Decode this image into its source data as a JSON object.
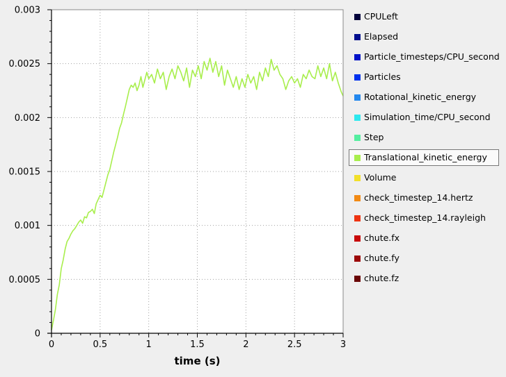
{
  "chart_data": {
    "type": "line",
    "title": "",
    "xlabel": "time (s)",
    "ylabel": "",
    "xlim": [
      0,
      3
    ],
    "ylim": [
      0,
      0.003
    ],
    "x_ticks": [
      {
        "value": 0,
        "label": "0"
      },
      {
        "value": 0.5,
        "label": "0.5"
      },
      {
        "value": 1,
        "label": "1"
      },
      {
        "value": 1.5,
        "label": "1.5"
      },
      {
        "value": 2,
        "label": "2"
      },
      {
        "value": 2.5,
        "label": "2.5"
      },
      {
        "value": 3,
        "label": "3"
      }
    ],
    "y_ticks": [
      {
        "value": 0,
        "label": "0"
      },
      {
        "value": 0.0005,
        "label": "0.0005"
      },
      {
        "value": 0.001,
        "label": "0.001"
      },
      {
        "value": 0.0015,
        "label": "0.0015"
      },
      {
        "value": 0.002,
        "label": "0.002"
      },
      {
        "value": 0.0025,
        "label": "0.0025"
      },
      {
        "value": 0.003,
        "label": "0.003"
      }
    ],
    "grid": true,
    "legend_position": "right",
    "series": [
      {
        "name": "Translational_kinetic_energy",
        "color": "#a8ee4c",
        "x": [
          0,
          0.02,
          0.04,
          0.06,
          0.08,
          0.1,
          0.12,
          0.14,
          0.16,
          0.18,
          0.2,
          0.22,
          0.24,
          0.26,
          0.28,
          0.3,
          0.32,
          0.34,
          0.36,
          0.38,
          0.4,
          0.42,
          0.44,
          0.46,
          0.48,
          0.5,
          0.52,
          0.54,
          0.56,
          0.58,
          0.6,
          0.62,
          0.64,
          0.66,
          0.68,
          0.7,
          0.72,
          0.74,
          0.76,
          0.78,
          0.8,
          0.82,
          0.84,
          0.86,
          0.88,
          0.9,
          0.92,
          0.94,
          0.96,
          0.98,
          1.0,
          1.03,
          1.06,
          1.09,
          1.12,
          1.15,
          1.18,
          1.21,
          1.24,
          1.27,
          1.3,
          1.33,
          1.36,
          1.39,
          1.42,
          1.45,
          1.48,
          1.51,
          1.54,
          1.57,
          1.6,
          1.63,
          1.66,
          1.69,
          1.72,
          1.75,
          1.78,
          1.81,
          1.84,
          1.87,
          1.9,
          1.93,
          1.96,
          1.99,
          2.02,
          2.05,
          2.08,
          2.11,
          2.14,
          2.17,
          2.2,
          2.23,
          2.26,
          2.29,
          2.32,
          2.35,
          2.38,
          2.41,
          2.44,
          2.47,
          2.5,
          2.53,
          2.56,
          2.59,
          2.62,
          2.65,
          2.68,
          2.71,
          2.74,
          2.77,
          2.8,
          2.83,
          2.86,
          2.89,
          2.92,
          2.95,
          2.98,
          3.0
        ],
        "values": [
          3e-05,
          0.00012,
          0.00022,
          0.00036,
          0.00045,
          0.0006,
          0.00068,
          0.00078,
          0.00085,
          0.00088,
          0.00092,
          0.00095,
          0.00097,
          0.001,
          0.00103,
          0.00105,
          0.00102,
          0.00108,
          0.00107,
          0.00112,
          0.00113,
          0.00115,
          0.00111,
          0.0012,
          0.00124,
          0.00128,
          0.00126,
          0.00133,
          0.0014,
          0.00147,
          0.00152,
          0.0016,
          0.00168,
          0.00175,
          0.00182,
          0.0019,
          0.00195,
          0.00203,
          0.0021,
          0.00218,
          0.00226,
          0.0023,
          0.00228,
          0.00232,
          0.00225,
          0.0023,
          0.00238,
          0.00228,
          0.00235,
          0.00242,
          0.00236,
          0.0024,
          0.00232,
          0.00245,
          0.00236,
          0.00242,
          0.00226,
          0.00238,
          0.00245,
          0.00236,
          0.00248,
          0.00242,
          0.00234,
          0.00246,
          0.00228,
          0.00244,
          0.00238,
          0.00248,
          0.00236,
          0.00252,
          0.00244,
          0.00255,
          0.00242,
          0.00252,
          0.00238,
          0.00248,
          0.0023,
          0.00244,
          0.00236,
          0.00228,
          0.00238,
          0.00226,
          0.00236,
          0.00228,
          0.0024,
          0.00232,
          0.00238,
          0.00226,
          0.00242,
          0.00234,
          0.00246,
          0.00238,
          0.00254,
          0.00244,
          0.00248,
          0.0024,
          0.00236,
          0.00226,
          0.00234,
          0.00238,
          0.00232,
          0.00236,
          0.00228,
          0.0024,
          0.00236,
          0.00244,
          0.00238,
          0.00236,
          0.00248,
          0.00238,
          0.00246,
          0.00236,
          0.0025,
          0.00234,
          0.00242,
          0.00232,
          0.00224,
          0.0022
        ]
      }
    ]
  },
  "legend": {
    "items": [
      {
        "label": "CPULeft",
        "color": "#00003a",
        "selected": false
      },
      {
        "label": "Elapsed",
        "color": "#000e8e",
        "selected": false
      },
      {
        "label": "Particle_timesteps/CPU_second",
        "color": "#0012c8",
        "selected": false
      },
      {
        "label": "Particles",
        "color": "#0032ee",
        "selected": false
      },
      {
        "label": "Rotational_kinetic_energy",
        "color": "#2388ee",
        "selected": false
      },
      {
        "label": "Simulation_time/CPU_second",
        "color": "#2ee8ee",
        "selected": false
      },
      {
        "label": "Step",
        "color": "#54eea0",
        "selected": false
      },
      {
        "label": "Translational_kinetic_energy",
        "color": "#a8ee4c",
        "selected": true
      },
      {
        "label": "Volume",
        "color": "#f2e02a",
        "selected": false
      },
      {
        "label": "check_timestep_14.hertz",
        "color": "#f28a14",
        "selected": false
      },
      {
        "label": "check_timestep_14.rayleigh",
        "color": "#ee3412",
        "selected": false
      },
      {
        "label": "chute.fx",
        "color": "#c80a0a",
        "selected": false
      },
      {
        "label": "chute.fy",
        "color": "#9c0a0a",
        "selected": false
      },
      {
        "label": "chute.fz",
        "color": "#6a0606",
        "selected": false
      }
    ]
  }
}
